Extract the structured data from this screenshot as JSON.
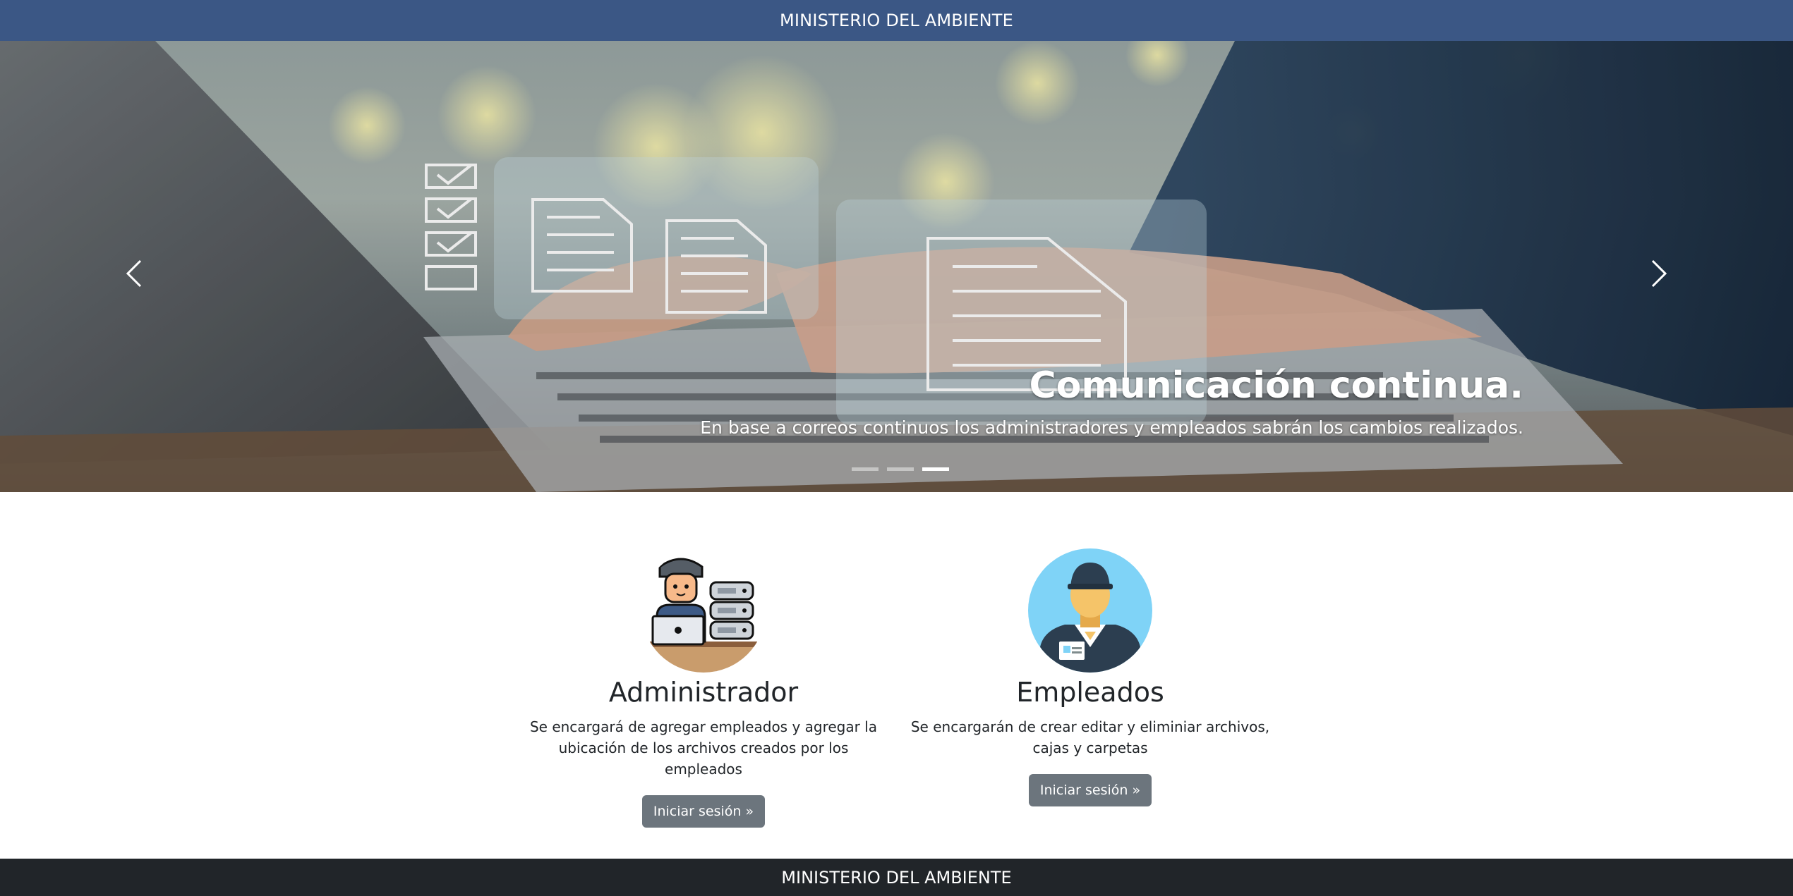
{
  "header": {
    "title": "MINISTERIO DEL AMBIENTE"
  },
  "carousel": {
    "slide_title": "Comunicación continua.",
    "slide_text": "En base a correos continuos los administradores y empleados sabrán los cambios realizados.",
    "indicator_count": 3,
    "active_indicator": 3
  },
  "cards": [
    {
      "title": "Administrador",
      "text_line1": "Se encargará de agregar empleados y agregar la",
      "text_line2": "ubicación de los archivos creados por los empleados",
      "button": "Iniciar sesión »"
    },
    {
      "title": "Empleados",
      "text_line1": "Se encargarán de crear editar y eliminiar archivos,",
      "text_line2": "cajas y carpetas",
      "button": "Iniciar sesión »"
    }
  ],
  "footer": {
    "title": "MINISTERIO DEL AMBIENTE"
  },
  "colors": {
    "header_bg": "#3b5785",
    "footer_bg": "#212529",
    "button_bg": "#6c757d"
  }
}
